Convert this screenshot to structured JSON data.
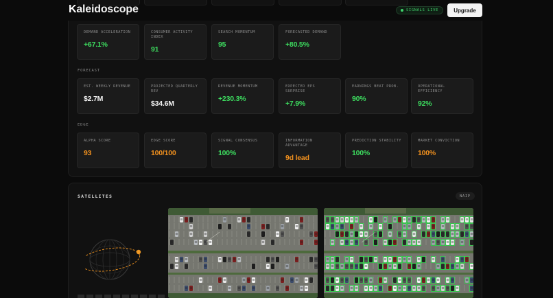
{
  "header": {
    "logo_k": "K",
    "logo_rest": "aleidoscope",
    "signals_live": "SIGNALS LIVE",
    "upgrade": "Upgrade"
  },
  "sections": {
    "row1": [
      {
        "label": "DEMAND ACCELERATION",
        "value": "+67.1%",
        "tone": "green"
      },
      {
        "label": "CONSUMER ACTIVITY INDEX",
        "value": "91",
        "tone": "green"
      },
      {
        "label": "SEARCH MOMENTUM",
        "value": "95",
        "tone": "green"
      },
      {
        "label": "FORECASTED DEMAND",
        "value": "+80.5%",
        "tone": "green"
      }
    ],
    "forecast_label": "FORECAST",
    "forecast": [
      {
        "label": "EST. WEEKLY REVENUE",
        "value": "$2.7M",
        "tone": "white"
      },
      {
        "label": "PROJECTED QUARTERLY REV",
        "value": "$34.6M",
        "tone": "white"
      },
      {
        "label": "REVENUE MOMENTUM",
        "value": "+230.3%",
        "tone": "green"
      },
      {
        "label": "EXPECTED EPS SURPRISE",
        "value": "+7.9%",
        "tone": "green"
      },
      {
        "label": "EARNINGS BEAT PROB.",
        "value": "90%",
        "tone": "green"
      },
      {
        "label": "OPERATIONAL EFFICIENCY",
        "value": "92%",
        "tone": "green"
      }
    ],
    "edge_label": "EDGE",
    "edge": [
      {
        "label": "ALPHA SCORE",
        "value": "93",
        "tone": "orange"
      },
      {
        "label": "EDGE SCORE",
        "value": "100/100",
        "tone": "orange"
      },
      {
        "label": "SIGNAL CONSENSUS",
        "value": "100%",
        "tone": "green"
      },
      {
        "label": "INFORMATION ADVANTAGE",
        "value": "9d lead",
        "tone": "orange"
      },
      {
        "label": "PREDICTION STABILITY",
        "value": "100%",
        "tone": "green"
      },
      {
        "label": "MARKET CONVICTION",
        "value": "100%",
        "tone": "orange"
      }
    ]
  },
  "satellites": {
    "title": "SATELLITES",
    "source_badge": "NAIP"
  },
  "colors": {
    "green": "#3ddc5f",
    "orange": "#f0901e",
    "white": "#f2f2f2",
    "accent_live": "#40d06a",
    "detection_box": "#2fd14a"
  },
  "icons": {
    "globe": "satellite-orbit-icon",
    "live_dot": "status-dot-icon"
  }
}
